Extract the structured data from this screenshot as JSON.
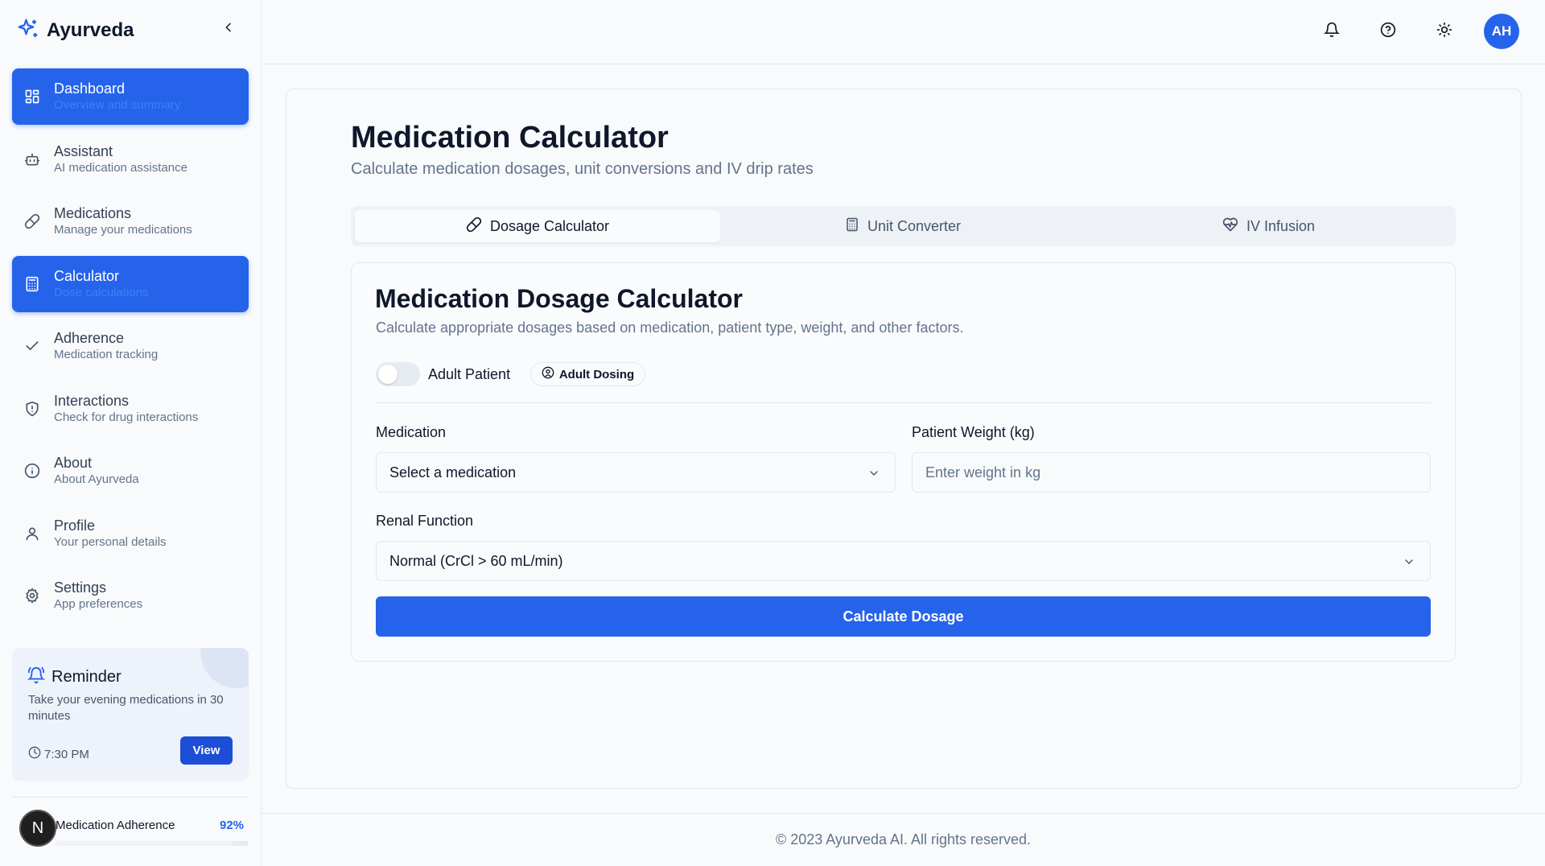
{
  "app": {
    "name": "Ayurveda"
  },
  "sidebar": {
    "items": [
      {
        "label": "Dashboard",
        "sub": "Overview and summary"
      },
      {
        "label": "Assistant",
        "sub": "AI medication assistance"
      },
      {
        "label": "Medications",
        "sub": "Manage your medications"
      },
      {
        "label": "Calculator",
        "sub": "Dose calculations"
      },
      {
        "label": "Adherence",
        "sub": "Medication tracking"
      },
      {
        "label": "Interactions",
        "sub": "Check for drug interactions"
      },
      {
        "label": "About",
        "sub": "About Ayurveda"
      },
      {
        "label": "Profile",
        "sub": "Your personal details"
      },
      {
        "label": "Settings",
        "sub": "App preferences"
      }
    ],
    "reminder": {
      "title": "Reminder",
      "text": "Take your evening medications in 30 minutes",
      "time": "7:30 PM",
      "button": "View"
    },
    "adherence": {
      "label": "Medication Adherence",
      "value": "92%",
      "percent": 92
    },
    "badge": "N"
  },
  "topbar": {
    "avatar": "AH"
  },
  "page": {
    "title": "Medication Calculator",
    "subtitle": "Calculate medication dosages, unit conversions and IV drip rates",
    "tabs": [
      {
        "label": "Dosage Calculator",
        "icon": "pill-icon",
        "active": true
      },
      {
        "label": "Unit Converter",
        "icon": "calculator-icon",
        "active": false
      },
      {
        "label": "IV Infusion",
        "icon": "heart-pulse-icon",
        "active": false
      }
    ]
  },
  "card": {
    "title": "Medication Dosage Calculator",
    "subtitle": "Calculate appropriate dosages based on medication, patient type, weight, and other factors.",
    "toggle_label": "Adult Patient",
    "chip": "Adult Dosing",
    "medication_label": "Medication",
    "medication_value": "Select a medication",
    "weight_label": "Patient Weight (kg)",
    "weight_placeholder": "Enter weight in kg",
    "renal_label": "Renal Function",
    "renal_value": "Normal (CrCl > 60 mL/min)",
    "button": "Calculate Dosage"
  },
  "footer": "© 2023 Ayurveda AI. All rights reserved.",
  "colors": {
    "accent": "#2563eb",
    "text": "#0f172a",
    "muted": "#64748b"
  }
}
